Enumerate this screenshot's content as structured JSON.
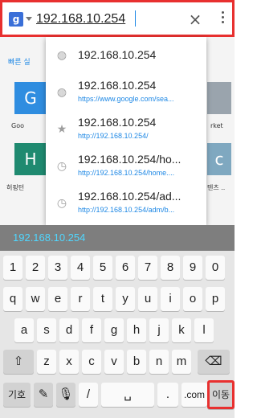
{
  "url_bar": {
    "engine_icon": "google-g-icon",
    "url_value": "192.168.10.254",
    "clear_icon": "×",
    "menu_icon": "more-vert-icon",
    "highlight_color": "#e8302f"
  },
  "page": {
    "quick_access_label": "빠른 실",
    "tiles": [
      {
        "letter": "G",
        "label": "Goo",
        "color": "#2f8de0"
      },
      {
        "letter": "H",
        "label": "허핑턴",
        "color": "#1f8a70"
      },
      {
        "letter": "",
        "label": "rket",
        "color": "#9aa4ad"
      },
      {
        "letter": "c",
        "label": "텐츠 ..",
        "color": "#7fa8c0"
      }
    ]
  },
  "suggestions": [
    {
      "icon": "globe-icon",
      "title": "192.168.10.254",
      "url": ""
    },
    {
      "icon": "globe-icon",
      "title": "192.168.10.254",
      "url": "https://www.google.com/sea..."
    },
    {
      "icon": "star-icon",
      "title": "192.168.10.254",
      "url": "http://192.168.10.254/"
    },
    {
      "icon": "history-icon",
      "title": "192.168.10.254/ho...",
      "url": "http://192.168.10.254/home...."
    },
    {
      "icon": "history-icon",
      "title": "192.168.10.254/ad...",
      "url": "http://192.168.10.254/adm/b..."
    }
  ],
  "keyboard": {
    "candidate": "192.168.10.254",
    "row_numbers": [
      "1",
      "2",
      "3",
      "4",
      "5",
      "6",
      "7",
      "8",
      "9",
      "0"
    ],
    "row_top": [
      "q",
      "w",
      "e",
      "r",
      "t",
      "y",
      "u",
      "i",
      "o",
      "p"
    ],
    "row_mid": [
      "a",
      "s",
      "d",
      "f",
      "g",
      "h",
      "j",
      "k",
      "l"
    ],
    "row_bottom": [
      "z",
      "x",
      "c",
      "v",
      "b",
      "n",
      "m"
    ],
    "shift_label": "⇧",
    "backspace_label": "⌫",
    "symbols_label": "기호",
    "slash_label": "/",
    "dotcom_label": ".com",
    "go_label": "이동"
  }
}
